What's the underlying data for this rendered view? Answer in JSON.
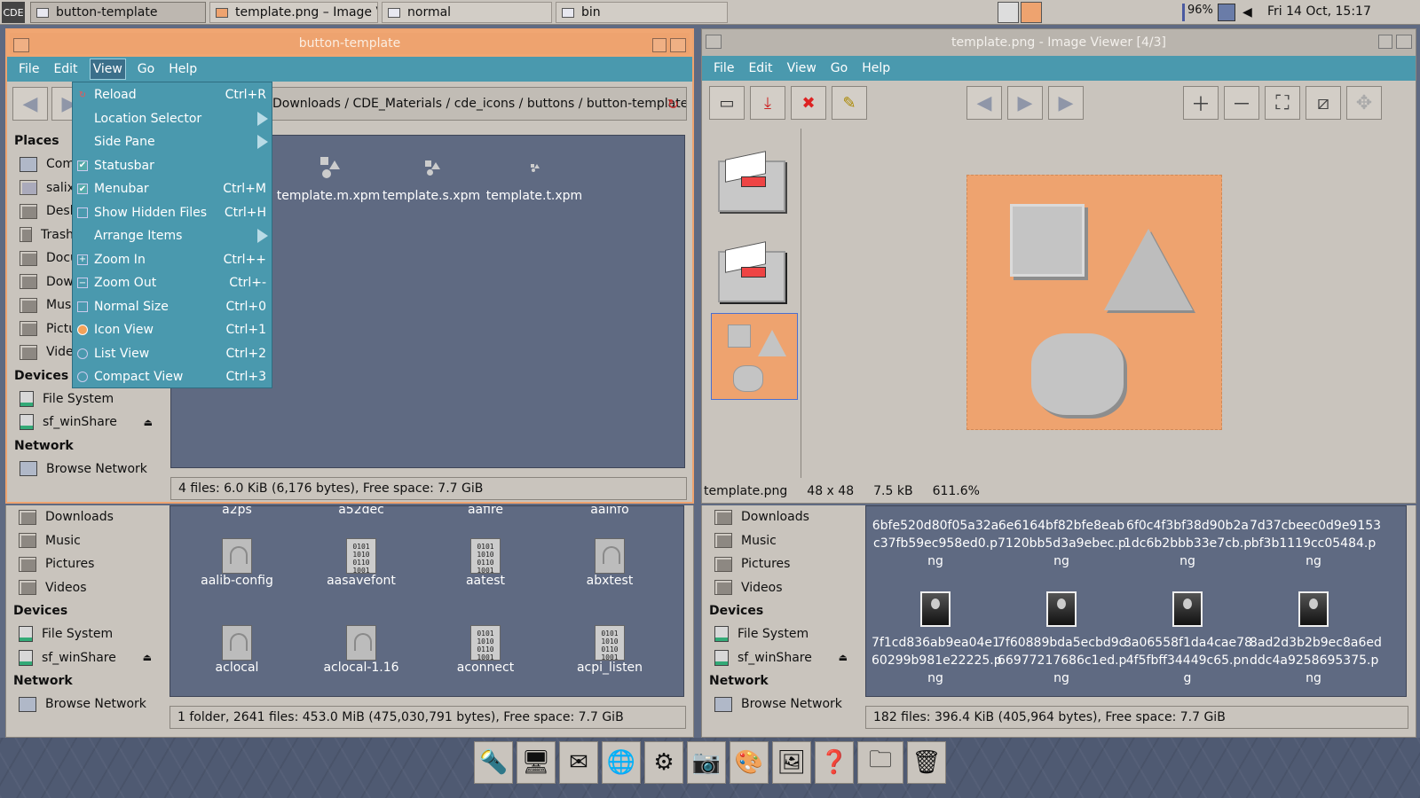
{
  "top_panel": {
    "logo": "CDE",
    "tasks": [
      {
        "label": "button-template"
      },
      {
        "label": "template.png – Image Vi..."
      },
      {
        "label": "normal"
      },
      {
        "label": "bin"
      }
    ],
    "battery": "96%",
    "clock": "Fri 14 Oct, 15:17"
  },
  "fm_top": {
    "title": "button-template",
    "menu": [
      "File",
      "Edit",
      "View",
      "Go",
      "Help"
    ],
    "path": "Downloads / CDE_Materials / cde_icons / buttons / button-template /",
    "places_header": "Places",
    "places": [
      "Computer",
      "salix",
      "Desktop",
      "Trash",
      "Documents",
      "Downloads",
      "Music",
      "Pictures",
      "Videos"
    ],
    "devices_header": "Devices",
    "devices": [
      "File System",
      "sf_winShare"
    ],
    "network_header": "Network",
    "network": [
      "Browse Network"
    ],
    "files": [
      "template.m.xpm",
      "template.s.xpm",
      "template.t.xpm"
    ],
    "status": "4 files: 6.0 KiB (6,176 bytes), Free space: 7.7 GiB"
  },
  "view_menu": {
    "items": [
      {
        "label": "Reload",
        "shortcut": "Ctrl+R"
      },
      {
        "label": "Location Selector",
        "shortcut": ""
      },
      {
        "label": "Side Pane",
        "shortcut": ""
      },
      {
        "label": "Statusbar",
        "shortcut": ""
      },
      {
        "label": "Menubar",
        "shortcut": "Ctrl+M"
      },
      {
        "label": "Show Hidden Files",
        "shortcut": "Ctrl+H"
      },
      {
        "label": "Arrange Items",
        "shortcut": ""
      },
      {
        "label": "Zoom In",
        "shortcut": "Ctrl++"
      },
      {
        "label": "Zoom Out",
        "shortcut": "Ctrl+-"
      },
      {
        "label": "Normal Size",
        "shortcut": "Ctrl+0"
      },
      {
        "label": "Icon View",
        "shortcut": "Ctrl+1"
      },
      {
        "label": "List View",
        "shortcut": "Ctrl+2"
      },
      {
        "label": "Compact View",
        "shortcut": "Ctrl+3"
      }
    ]
  },
  "fm_bottom": {
    "places": [
      "Downloads",
      "Music",
      "Pictures",
      "Videos"
    ],
    "devices_header": "Devices",
    "devices": [
      "File System",
      "sf_winShare"
    ],
    "network_header": "Network",
    "network": [
      "Browse Network"
    ],
    "top_row": [
      "a2ps",
      "a52dec",
      "aafire",
      "aainfo"
    ],
    "files": [
      "aalib-config",
      "aasavefont",
      "aatest",
      "abxtest",
      "aclocal",
      "aclocal-1.16",
      "aconnect",
      "acpi_listen"
    ],
    "status": "1 folder, 2641 files: 453.0 MiB (475,030,791 bytes), Free space: 7.7 GiB"
  },
  "image_viewer": {
    "title": "template.png - Image Viewer [4/3]",
    "menu": [
      "File",
      "Edit",
      "View",
      "Go",
      "Help"
    ],
    "status_name": "template.png",
    "status_dims": "48 x 48",
    "status_size": "7.5 kB",
    "status_zoom": "611.6%"
  },
  "fm_right": {
    "places": [
      "Downloads",
      "Music",
      "Pictures",
      "Videos"
    ],
    "devices_header": "Devices",
    "devices": [
      "File System",
      "sf_winShare"
    ],
    "network_header": "Network",
    "network": [
      "Browse Network"
    ],
    "files_row1": [
      {
        "l1": "6bfe520d80f05a32a",
        "l2": "c37fb59ec958ed0.p",
        "l3": "ng"
      },
      {
        "l1": "6e6164bf82bfe8eab",
        "l2": "7120bb5d3a9ebec.p",
        "l3": "ng"
      },
      {
        "l1": "6f0c4f3bf38d90b2a",
        "l2": "1dc6b2bbb33e7cb.p",
        "l3": "ng"
      },
      {
        "l1": "7d37cbeec0d9e9153",
        "l2": "bf3b1119cc05484.p",
        "l3": "ng"
      }
    ],
    "files_row2": [
      {
        "l1": "7f1cd836ab9ea04e1",
        "l2": "60299b981e22225.p",
        "l3": "ng"
      },
      {
        "l1": "7f60889bda5ecbd9c",
        "l2": "66977217686c1ed.p",
        "l3": "ng"
      },
      {
        "l1": "8a06558f1da4cae78",
        "l2": "4f5fbff34449c65.pn",
        "l3": "g"
      },
      {
        "l1": "8ad2d3b2b9ec8a6ed",
        "l2": "ddc4a9258695375.p",
        "l3": "ng"
      }
    ],
    "status": "182 files: 396.4 KiB (405,964 bytes), Free space: 7.7 GiB"
  },
  "colors": {
    "accent_orange": "#eea36f",
    "menu_blue": "#4a99ae",
    "pane_bg": "#5f6a82"
  }
}
